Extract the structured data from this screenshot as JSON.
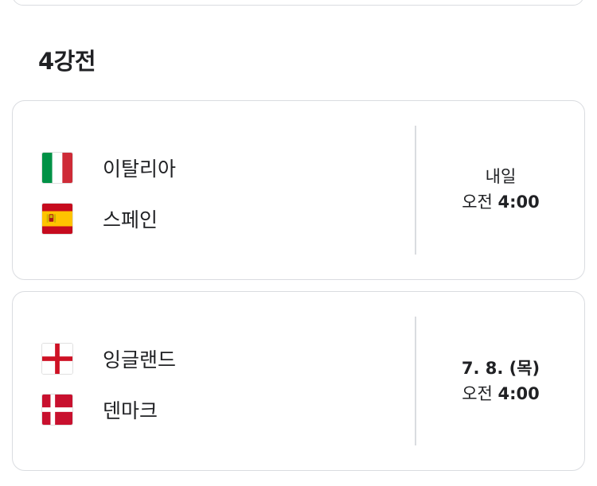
{
  "section": {
    "title": "4강전"
  },
  "matches": [
    {
      "teams": [
        {
          "name": "이탈리아",
          "flag": "italy-flag-icon"
        },
        {
          "name": "스페인",
          "flag": "spain-flag-icon"
        }
      ],
      "date": "내일",
      "ampm": "오전",
      "time": "4:00"
    },
    {
      "teams": [
        {
          "name": "잉글랜드",
          "flag": "england-flag-icon"
        },
        {
          "name": "덴마크",
          "flag": "denmark-flag-icon"
        }
      ],
      "date": "7. 8. (목)",
      "ampm": "오전",
      "time": "4:00"
    }
  ],
  "colors": {
    "border": "#dadce0",
    "italy_green": "#009246",
    "italy_red": "#ce2b37",
    "spain_red": "#c60b1e",
    "spain_yellow": "#ffc400",
    "england_red": "#ce1124",
    "denmark_red": "#c8102e"
  }
}
